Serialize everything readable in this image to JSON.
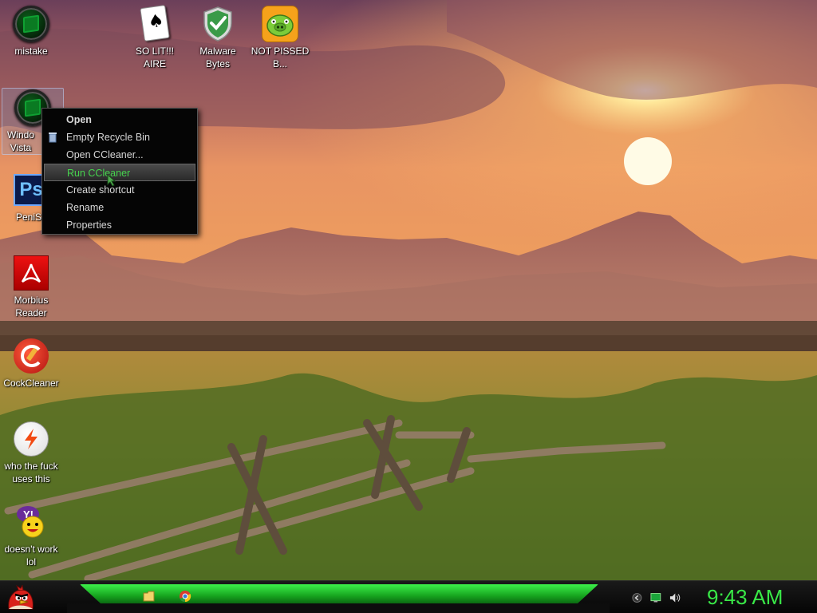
{
  "desktop": {
    "icons": [
      {
        "label": "mistake",
        "icon": "green-orb-icon"
      },
      {
        "label": "SO LIT!!! AIRE",
        "icon": "playing-cards-icon"
      },
      {
        "label": "Malware Bytes",
        "icon": "shield-check-icon"
      },
      {
        "label": "NOT PISSED B...",
        "icon": "green-pig-icon"
      },
      {
        "label": "Windo Vista",
        "icon": "green-orb-icon"
      },
      {
        "label": "PeniS",
        "icon": "photoshop-icon"
      },
      {
        "label": "Morbius Reader",
        "icon": "pdf-reader-icon"
      },
      {
        "label": "CockCleaner",
        "icon": "ccleaner-icon"
      },
      {
        "label": "who the fuck uses this",
        "icon": "flash-icon"
      },
      {
        "label": "doesn't work lol",
        "icon": "yahoo-messenger-icon"
      }
    ]
  },
  "context_menu": {
    "items": [
      {
        "label": "Open",
        "bold": true
      },
      {
        "label": "Empty Recycle Bin",
        "icon": "recycle-bin-icon"
      },
      {
        "label": "Open CCleaner..."
      },
      {
        "label": "Run CCleaner",
        "highlighted": true
      },
      {
        "label": "Create shortcut"
      },
      {
        "label": "Rename"
      },
      {
        "label": "Properties"
      }
    ]
  },
  "taskbar": {
    "start_icon": "angry-bird-icon",
    "quick_launch": [
      "folder-icon",
      "chrome-icon"
    ],
    "tray": [
      "chevron-left-icon",
      "network-icon",
      "volume-icon"
    ],
    "clock": "9:43 AM"
  },
  "colors": {
    "accent": "#39e847",
    "menu_bg": "#050505",
    "menu_highlight_text": "#46d34e"
  }
}
